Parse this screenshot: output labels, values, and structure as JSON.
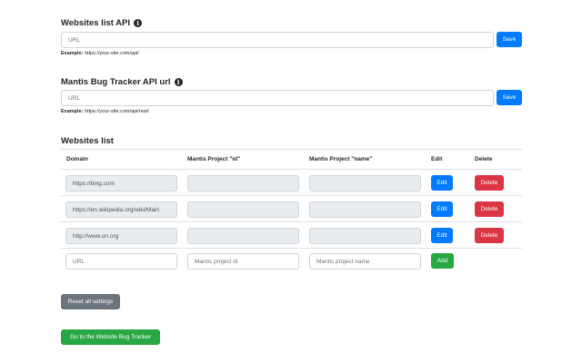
{
  "api_section": {
    "title": "Websites list API",
    "url_placeholder": "URL",
    "save_label": "Save",
    "example_label": "Example:",
    "example_value": "https://your-site.com/api/"
  },
  "mantis_section": {
    "title": "Mantis Bug Tracker API url",
    "url_placeholder": "URL",
    "save_label": "Save",
    "example_label": "Example:",
    "example_value": "https://your-site.com/api/rest/"
  },
  "websites_list": {
    "title": "Websites list",
    "columns": [
      "Domain",
      "Mantis Project \"id\"",
      "Mantis Project \"name\"",
      "Edit",
      "Delete"
    ],
    "rows": [
      {
        "domain": "https://bing.com",
        "project_id": "",
        "project_name": "",
        "edit_label": "Edit",
        "delete_label": "Delete"
      },
      {
        "domain": "https://en.wikipedia.org/wiki/Main",
        "project_id": "",
        "project_name": "",
        "edit_label": "Edit",
        "delete_label": "Delete"
      },
      {
        "domain": "http://www.un.org",
        "project_id": "",
        "project_name": "",
        "edit_label": "Edit",
        "delete_label": "Delete"
      }
    ],
    "new_row": {
      "domain_placeholder": "URL",
      "id_placeholder": "Mantis project id",
      "name_placeholder": "Mantis project name",
      "add_label": "Add"
    }
  },
  "reset_label": "Reset all settings",
  "go_label": "Go to the Website Bug Tracker",
  "icons": {
    "info": "info-circle-icon"
  },
  "colors": {
    "primary": "#007bff",
    "danger": "#dc3545",
    "success": "#28a745",
    "secondary": "#6c757d"
  }
}
